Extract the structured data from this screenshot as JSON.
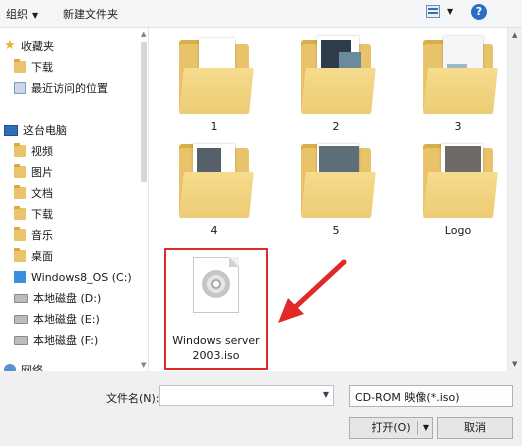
{
  "toolbar": {
    "organize": "组织",
    "new_folder": "新建文件夹",
    "help": "?"
  },
  "nav": {
    "favorites": "收藏夹",
    "downloads": "下载",
    "recent": "最近访问的位置",
    "this_pc": "这台电脑",
    "videos": "视频",
    "pictures": "图片",
    "documents": "文档",
    "downloads2": "下载",
    "music": "音乐",
    "desktop": "桌面",
    "c_drive": "Windows8_OS (C:)",
    "d_drive": "本地磁盘 (D:)",
    "e_drive": "本地磁盘 (E:)",
    "f_drive": "本地磁盘 (F:)",
    "network": "网络"
  },
  "items": [
    {
      "name": "1"
    },
    {
      "name": "2"
    },
    {
      "name": "3"
    },
    {
      "name": "4"
    },
    {
      "name": "5"
    },
    {
      "name": "Logo"
    }
  ],
  "iso_file": {
    "line1": "Windows server",
    "line2": "2003.iso",
    "icon": "disc-image-icon"
  },
  "bottom": {
    "filename_label": "文件名(N):",
    "filename_value": "",
    "filetype": "CD-ROM 映像(*.iso)",
    "open": "打开(O)",
    "cancel": "取消"
  },
  "colors": {
    "annotation": "#e02a2a",
    "folder": "#e8c36a"
  }
}
